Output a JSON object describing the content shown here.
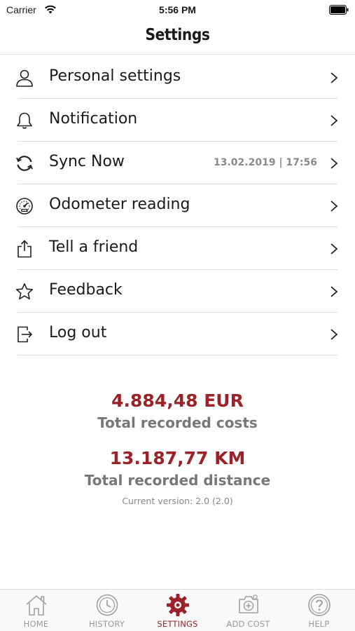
{
  "status_bar": {
    "carrier": "Carrier",
    "time": "5:56 PM"
  },
  "header": {
    "title": "Settings"
  },
  "menu": {
    "items": [
      {
        "label": "Personal settings",
        "icon": "person-icon",
        "detail": ""
      },
      {
        "label": "Notification",
        "icon": "bell-icon",
        "detail": ""
      },
      {
        "label": "Sync Now",
        "icon": "sync-icon",
        "detail": "13.02.2019 | 17:56"
      },
      {
        "label": "Odometer reading",
        "icon": "speedometer-icon",
        "detail": ""
      },
      {
        "label": "Tell a friend",
        "icon": "share-icon",
        "detail": ""
      },
      {
        "label": "Feedback",
        "icon": "star-icon",
        "detail": ""
      },
      {
        "label": "Log out",
        "icon": "logout-icon",
        "detail": ""
      }
    ]
  },
  "stats": {
    "total_costs_value": "4.884,48 EUR",
    "total_costs_label": "Total recorded costs",
    "total_distance_value": "13.187,77 KM",
    "total_distance_label": "Total recorded distance",
    "version": "Current version: 2.0 (2.0)"
  },
  "tab_bar": {
    "tabs": [
      {
        "label": "HOME",
        "icon": "home-icon",
        "active": false
      },
      {
        "label": "HISTORY",
        "icon": "history-icon",
        "active": false
      },
      {
        "label": "SETTINGS",
        "icon": "gear-icon",
        "active": true
      },
      {
        "label": "ADD COST",
        "icon": "add-cost-icon",
        "active": false
      },
      {
        "label": "HELP",
        "icon": "help-icon",
        "active": false
      }
    ]
  },
  "colors": {
    "accent": "#9b2226",
    "secondary_text": "#777777",
    "inactive_tab": "#999999"
  }
}
